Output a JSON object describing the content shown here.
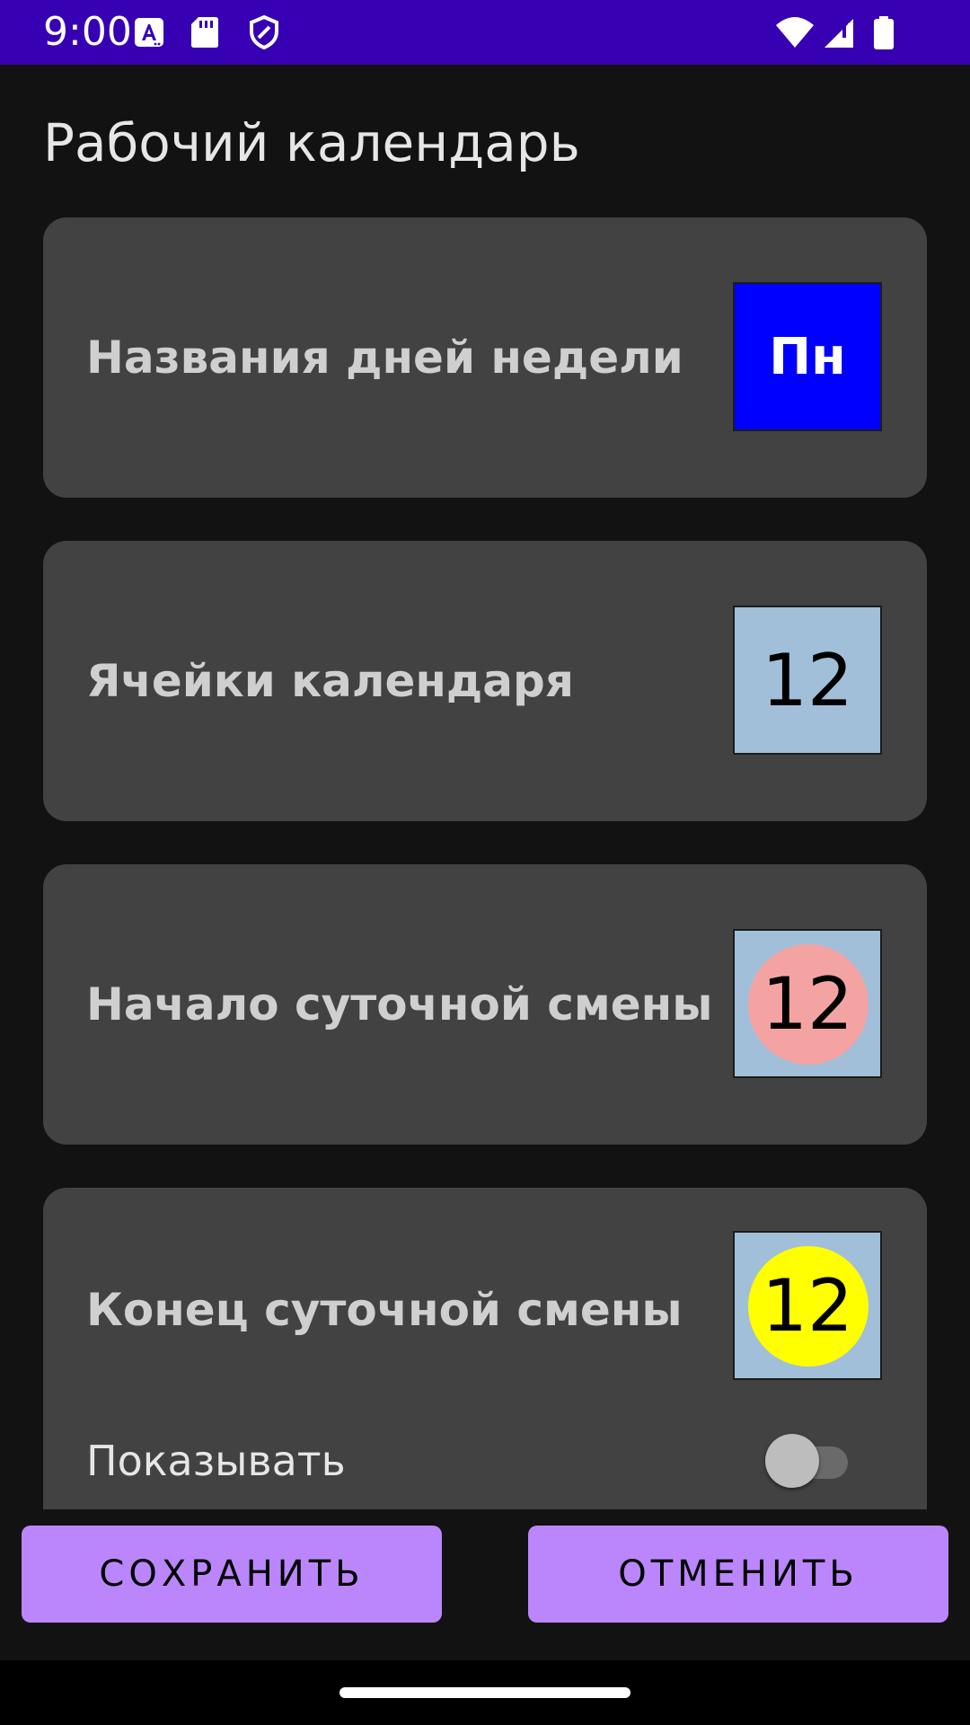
{
  "status_bar": {
    "time": "9:00",
    "background": "#3700b3",
    "icons": [
      "font-notification-icon",
      "sd-card-icon",
      "shield-icon",
      "wifi-icon",
      "signal-icon",
      "battery-icon"
    ]
  },
  "page": {
    "title": "Рабочий календарь"
  },
  "cards": [
    {
      "label": "Названия дней недели",
      "preview_text": "Пн",
      "preview_background": "#0000ff",
      "preview_text_color": "#ffffff"
    },
    {
      "label": "Ячейки календаря",
      "preview_text": "12",
      "preview_background": "#a2bfd9",
      "preview_text_color": "#000000"
    },
    {
      "label": "Начало суточной смены",
      "preview_text": "12",
      "preview_background": "#a2bfd9",
      "preview_circle_color": "#f4a3a3",
      "preview_text_color": "#000000"
    },
    {
      "label": "Конец суточной смены",
      "preview_text": "12",
      "preview_background": "#a2bfd9",
      "preview_circle_color": "#ffff00",
      "preview_text_color": "#000000",
      "switch_label": "Показывать",
      "switch_on": false
    }
  ],
  "buttons": {
    "save": "СОХРАНИТЬ",
    "cancel": "ОТМЕНИТЬ",
    "color": "#bb86fc"
  }
}
